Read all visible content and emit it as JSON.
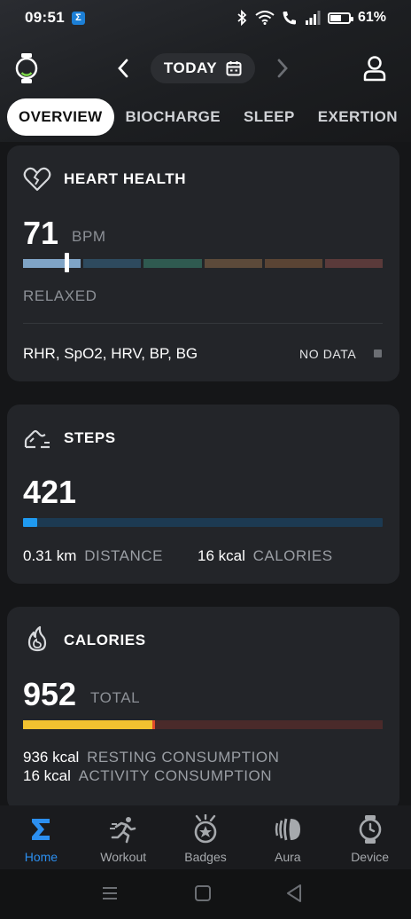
{
  "status_bar": {
    "time": "09:51",
    "app_badge": "Σ",
    "battery": "61%"
  },
  "header": {
    "date_label": "TODAY"
  },
  "tabs": [
    {
      "label": "OVERVIEW",
      "active": true
    },
    {
      "label": "BIOCHARGE",
      "active": false
    },
    {
      "label": "SLEEP",
      "active": false
    },
    {
      "label": "EXERTION",
      "active": false
    }
  ],
  "heart_health": {
    "title": "HEART HEALTH",
    "value": "71",
    "unit": "BPM",
    "state": "RELAXED",
    "zone_colors": [
      "#7fa4c6",
      "#2e4a5e",
      "#2f5a50",
      "#5c4a3a",
      "#5a4434",
      "#5a3a3a"
    ],
    "indicator_fraction": 0.12,
    "metrics_label": "RHR, SpO2, HRV, BP, BG",
    "metrics_status": "NO DATA"
  },
  "steps": {
    "title": "STEPS",
    "value": "421",
    "progress_fraction": 0.04,
    "bar_color": "#1f9af0",
    "bar_track_color": "#1c3a52",
    "distance_value": "0.31 km",
    "distance_label": "DISTANCE",
    "calories_value": "16 kcal",
    "calories_label": "CALORIES"
  },
  "calories": {
    "title": "CALORIES",
    "value": "952",
    "unit": "TOTAL",
    "resting_fraction": 0.36,
    "resting_color": "#f2c230",
    "activity_color": "#e04a2a",
    "track_color": "#4a2a2a",
    "resting_value": "936 kcal",
    "resting_label": "RESTING CONSUMPTION",
    "activity_value": "16 kcal",
    "activity_label": "ACTIVITY CONSUMPTION"
  },
  "bottom_nav": [
    {
      "label": "Home",
      "icon": "sigma-icon",
      "active": true
    },
    {
      "label": "Workout",
      "icon": "runner-icon",
      "active": false
    },
    {
      "label": "Badges",
      "icon": "medal-icon",
      "active": false
    },
    {
      "label": "Aura",
      "icon": "aura-icon",
      "active": false
    },
    {
      "label": "Device",
      "icon": "watch-icon",
      "active": false
    }
  ]
}
